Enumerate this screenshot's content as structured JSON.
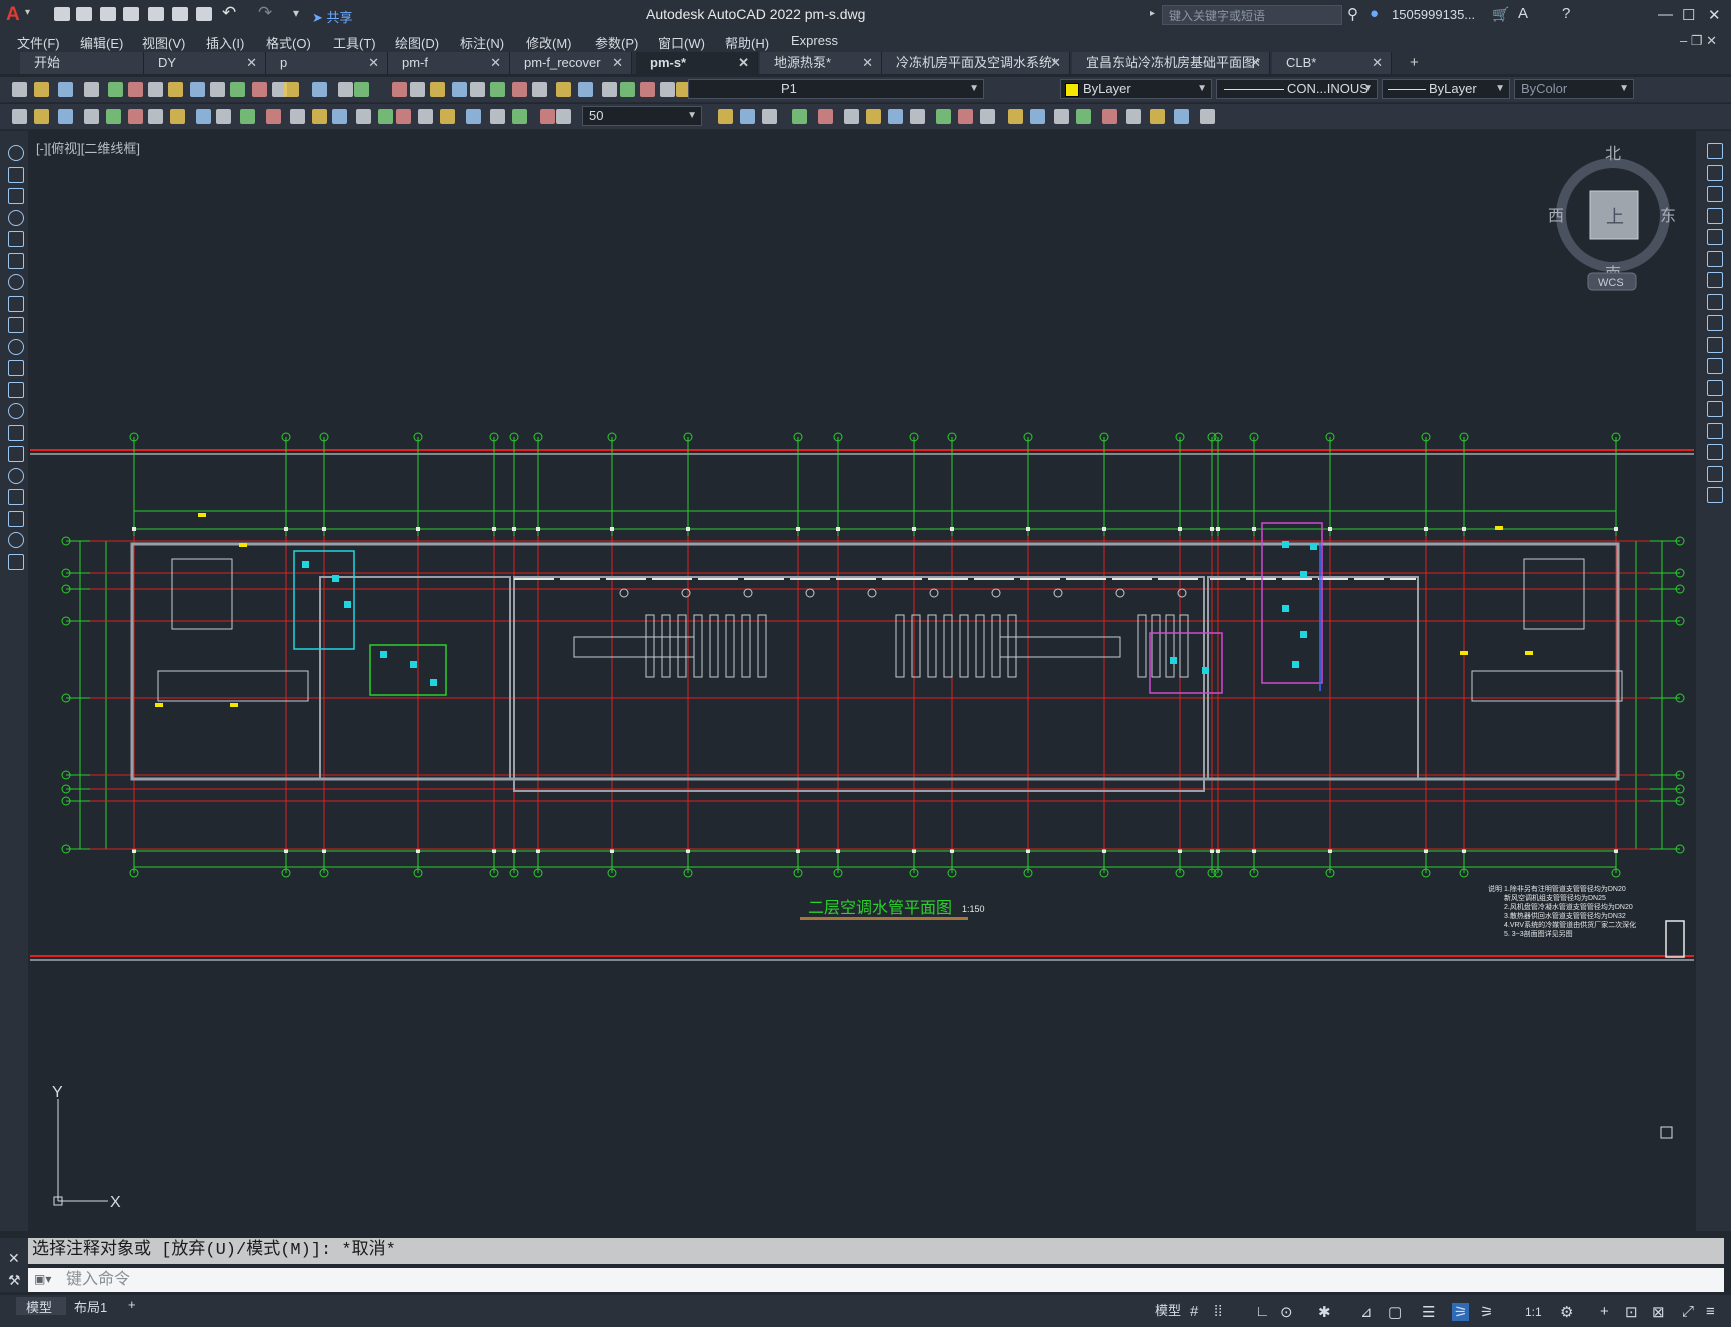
{
  "app": {
    "logo": "A",
    "title": "Autodesk AutoCAD 2022    pm-s.dwg",
    "share_label": "共享",
    "search_placeholder": "键入关键字或短语",
    "user": "1505999135...",
    "window_controls": [
      "—",
      "☐",
      "✕"
    ]
  },
  "menu": [
    "文件(F)",
    "编辑(E)",
    "视图(V)",
    "插入(I)",
    "格式(O)",
    "工具(T)",
    "绘图(D)",
    "标注(N)",
    "修改(M)",
    "参数(P)",
    "窗口(W)",
    "帮助(H)",
    "Express"
  ],
  "tabs": [
    {
      "label": "开始",
      "active": false
    },
    {
      "label": "DY",
      "active": false
    },
    {
      "label": "p",
      "active": false
    },
    {
      "label": "pm-f",
      "active": false
    },
    {
      "label": "pm-f_recover",
      "active": false
    },
    {
      "label": "pm-s*",
      "active": true
    },
    {
      "label": "地源热泵*",
      "active": false
    },
    {
      "label": "冷冻机房平面及空调水系统*",
      "active": false
    },
    {
      "label": "宜昌东站冷冻机房基础平面图*",
      "active": false
    },
    {
      "label": "CLB*",
      "active": false
    }
  ],
  "toolbar": {
    "layer_name": "P1",
    "color": "ByLayer",
    "linetype": "CON...INOUS",
    "lineweight": "ByLayer",
    "plotstyle": "ByColor",
    "dim_scale": "50"
  },
  "viewport_label": "[-][俯视][二维线框]",
  "viewcube": {
    "north": "北",
    "south": "南",
    "east": "东",
    "west": "西",
    "face": "上",
    "wcs": "WCS"
  },
  "drawing": {
    "title": "二层空调水管平面图",
    "scale": "1:150",
    "grid_top": [
      "21",
      "20",
      "19",
      "18",
      "17",
      "16",
      "15",
      "14",
      "13",
      "12",
      "11",
      "10",
      "9",
      "8",
      "7",
      "6",
      "5",
      "4",
      "3",
      "2",
      "1"
    ],
    "grid_side": [
      "L",
      "K",
      "J",
      "H",
      "G",
      "F",
      "E",
      "D"
    ],
    "notes_header": "说明",
    "notes": [
      "1.除非另有注明管道支管管径均为DN20",
      "  新风空调机组支管管径均为DN25",
      "2.风机盘管冷凝水管道支管管径均为DN20",
      "3.散热器供回水管道支管管径均为DN32",
      "4.VRV系统的冷媒管道由供货厂家二次深化",
      "5. 3~3剖面图详见另图"
    ]
  },
  "axis": {
    "x": "X",
    "y": "Y"
  },
  "command": {
    "history": "选择注释对象或 [放弃(U)/模式(M)]: *取消*",
    "placeholder": "键入命令"
  },
  "status": {
    "tabs": [
      "模型",
      "布局1",
      "+"
    ],
    "model_label": "模型",
    "scale": "1:1"
  },
  "colors": {
    "background": "#212830",
    "grid_green": "#2bd12b",
    "axis_red": "#e0221e",
    "wall_gray": "#9aa0a8",
    "pipe_magenta": "#d14bd1",
    "pipe_cyan": "#1fd6e0",
    "title_green": "#2cd12c"
  }
}
